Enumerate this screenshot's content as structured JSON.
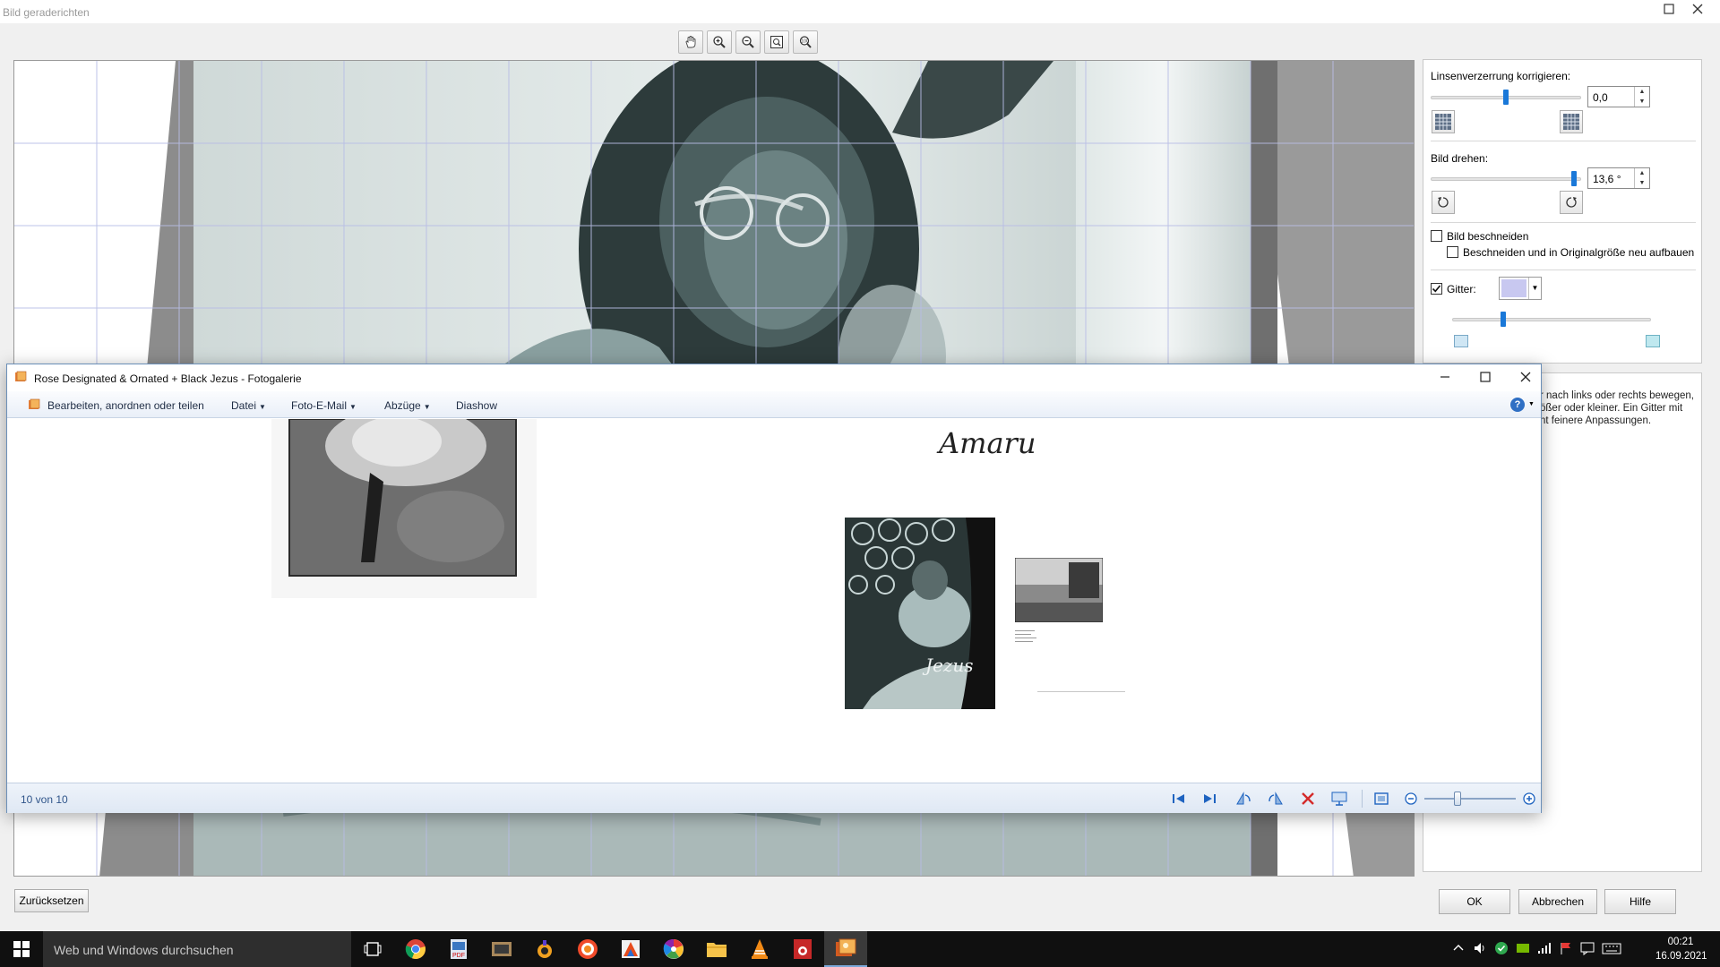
{
  "dialog": {
    "title": "Bild geraderichten",
    "maximize_icon": "maximize-icon",
    "close_icon": "close-icon",
    "toolbar": [
      "hand-icon",
      "zoom-in-icon",
      "zoom-out-icon",
      "fit-icon",
      "actual-size-icon"
    ],
    "lens": {
      "label": "Linsenverzerrung korrigieren:",
      "value": "0,0",
      "slider_fraction": 0.5
    },
    "rotate": {
      "label": "Bild drehen:",
      "value": "13,6 °",
      "slider_fraction": 0.97
    },
    "crop": {
      "label": "Bild beschneiden",
      "checked": false
    },
    "crop_rebuild": {
      "label": "Beschneiden und in Originalgröße neu aufbauen",
      "checked": false
    },
    "grid": {
      "label": "Gitter:",
      "checked": true,
      "color": "#c8c8f0",
      "slider_fraction": 0.25
    },
    "hint_lines": [
      "r nach links oder rechts bewegen,",
      "ößer oder kleiner. Ein Gitter mit",
      "nt feinere Anpassungen."
    ],
    "buttons": {
      "reset": "Zurücksetzen",
      "ok": "OK",
      "cancel": "Abbrechen",
      "help": "Hilfe"
    }
  },
  "gallery": {
    "title": "Rose Designated & Ornated + Black Jezus - Fotogalerie",
    "menu": {
      "edit": "Bearbeiten, anordnen oder teilen",
      "file": "Datei",
      "email": "Foto-E-Mail",
      "prints": "Abzüge",
      "slideshow": "Diashow"
    },
    "page_heading": "Amaru",
    "counter": "10 von 10",
    "zoom_fraction": 0.35,
    "nav_icons": [
      "first-icon",
      "last-icon",
      "rotate-left-icon",
      "rotate-right-icon",
      "delete-icon",
      "slideshow-icon",
      "fit-window-icon",
      "zoom-out-icon",
      "zoom-in-icon"
    ]
  },
  "taskbar": {
    "search_placeholder": "Web und Windows durchsuchen",
    "time": "00:21",
    "date": "16.09.2021",
    "apps": [
      "task-view-icon",
      "chrome-icon",
      "pdf-app-icon",
      "photo-app-icon",
      "media-app-icon",
      "browser-icon",
      "paint-app-icon",
      "picasa-icon",
      "file-explorer-icon",
      "vlc-icon",
      "photo-edit-icon",
      "photo-gallery-icon"
    ]
  },
  "colors": {
    "accent": "#1a78d8",
    "photo_tint": "#5e7b7b",
    "gallery_status": "#30558a"
  }
}
